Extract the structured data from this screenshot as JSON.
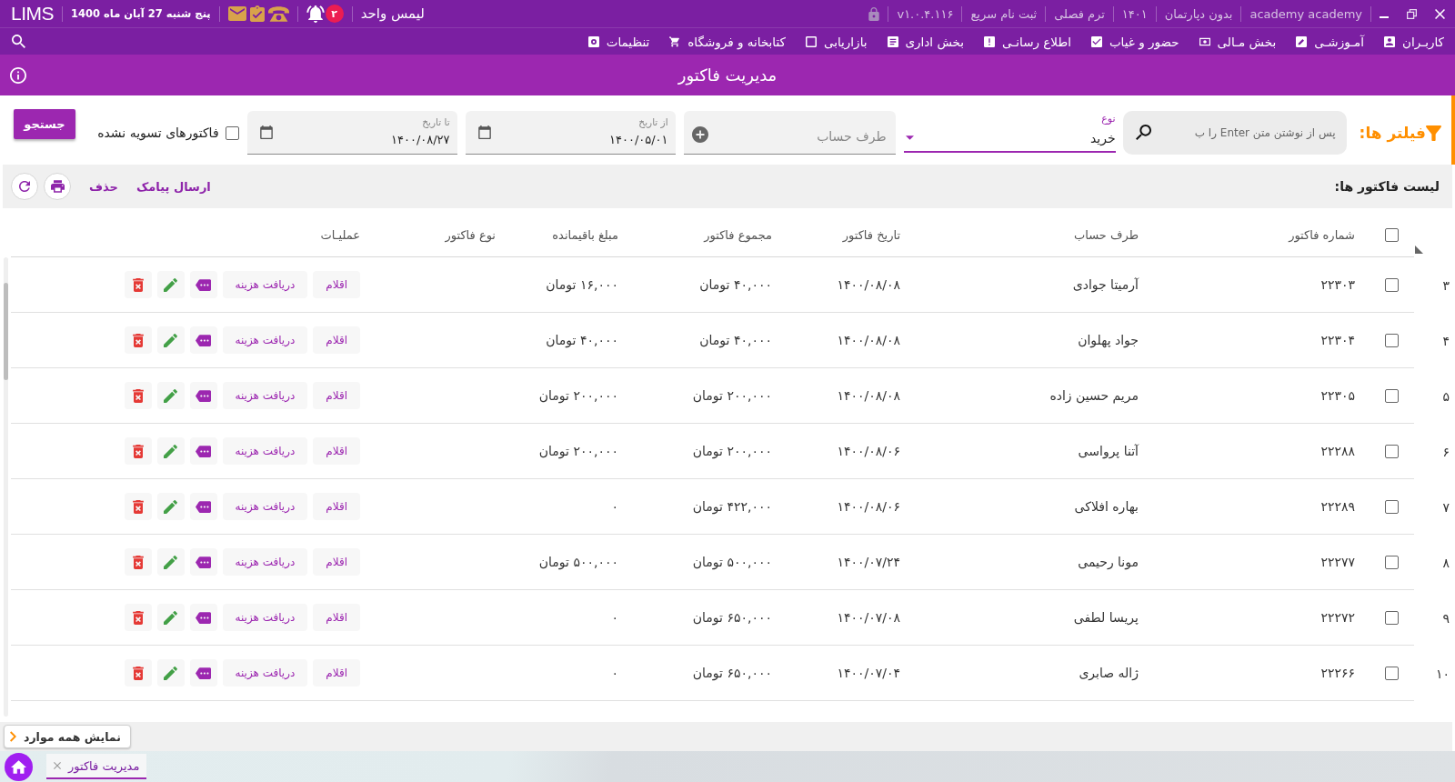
{
  "title_bar": {
    "info": [
      "academy academy",
      "بدون دپارتمان",
      "۱۴۰۱",
      "ترم فصلی",
      "ثبت نام سریع",
      "v۱.۰.۴.۱۱۶"
    ],
    "app_name": "لیمس واحد",
    "notification_count": "۲",
    "date": "پنج شنبه 27 آبان ماه 1400",
    "logo": "LIMS"
  },
  "menu": {
    "items": [
      "کاربـران",
      "آمـوزشـی",
      "بخش مـالی",
      "حضور و غیاب",
      "اطلاع رسانـی",
      "بخش اداری",
      "بازاریابی",
      "کتابخانه و فروشگاه",
      "تنظیمات"
    ]
  },
  "header": {
    "title": "مدیریت فاکتور"
  },
  "filters": {
    "title": "فیلتر ها:",
    "search": {
      "placeholder": "پس از نوشتن متن Enter را ب"
    },
    "type": {
      "label": "نوع",
      "value": "خرید"
    },
    "account": {
      "placeholder": "طرف حساب"
    },
    "from_date": {
      "label": "از تاریخ",
      "value": "۱۴۰۰/۰۵/۰۱"
    },
    "to_date": {
      "label": "تا تاریخ",
      "value": "۱۴۰۰/۰۸/۲۷"
    },
    "unsettled_only": {
      "label": "فاکتورهای تسویه نشده",
      "checked": false
    },
    "search_button": "جستجو"
  },
  "invoice_list": {
    "title": "لیست فاکتور ها:",
    "actions": [
      "ارسال پیامک",
      "حذف"
    ]
  },
  "table": {
    "all_checked": false,
    "columns": [
      "شماره فاکتور",
      "طرف حساب",
      "تاریخ فاکتور",
      "مجموع فاکتور",
      "مبلغ باقیمانده",
      "نوع فاکتور",
      "عملیـات"
    ],
    "rows": [
      {
        "index": "۳",
        "checked": false,
        "number": "۲۲۳۰۳",
        "account": "آرمیتا جوادی",
        "date": "۱۴۰۰/۰۸/۰۸",
        "total": "۴۰,۰۰۰ تومان",
        "remaining": "۱۶,۰۰۰ تومان",
        "buttons": [
          "اقلام",
          "دریافت هزینه"
        ]
      },
      {
        "index": "۴",
        "checked": false,
        "number": "۲۲۳۰۴",
        "account": "جواد پهلوان",
        "date": "۱۴۰۰/۰۸/۰۸",
        "total": "۴۰,۰۰۰ تومان",
        "remaining": "۴۰,۰۰۰ تومان",
        "buttons": [
          "اقلام",
          "دریافت هزینه"
        ]
      },
      {
        "index": "۵",
        "checked": false,
        "number": "۲۲۳۰۵",
        "account": "مریم حسین زاده",
        "date": "۱۴۰۰/۰۸/۰۸",
        "total": "۲۰۰,۰۰۰ تومان",
        "remaining": "۲۰۰,۰۰۰ تومان",
        "buttons": [
          "اقلام",
          "دریافت هزینه"
        ]
      },
      {
        "index": "۶",
        "checked": false,
        "number": "۲۲۲۸۸",
        "account": "آتنا پرواسی",
        "date": "۱۴۰۰/۰۸/۰۶",
        "total": "۲۰۰,۰۰۰ تومان",
        "remaining": "۲۰۰,۰۰۰ تومان",
        "buttons": [
          "اقلام",
          "دریافت هزینه"
        ]
      },
      {
        "index": "۷",
        "checked": false,
        "number": "۲۲۲۸۹",
        "account": "بهاره افلاکی",
        "date": "۱۴۰۰/۰۸/۰۶",
        "total": "۴۲۲,۰۰۰ تومان",
        "remaining": "۰",
        "buttons": [
          "اقلام",
          "دریافت هزینه"
        ]
      },
      {
        "index": "۸",
        "checked": false,
        "number": "۲۲۲۷۷",
        "account": "مونا رحیمی",
        "date": "۱۴۰۰/۰۷/۲۴",
        "total": "۵۰۰,۰۰۰ تومان",
        "remaining": "۵۰۰,۰۰۰ تومان",
        "buttons": [
          "اقلام",
          "دریافت هزینه"
        ]
      },
      {
        "index": "۹",
        "checked": false,
        "number": "۲۲۲۷۲",
        "account": "پریسا لطفی",
        "date": "۱۴۰۰/۰۷/۰۸",
        "total": "۶۵۰,۰۰۰ تومان",
        "remaining": "۰",
        "buttons": [
          "اقلام",
          "دریافت هزینه"
        ]
      },
      {
        "index": "۱۰",
        "checked": false,
        "number": "۲۲۲۶۶",
        "account": "ژاله صابری",
        "date": "۱۴۰۰/۰۷/۰۴",
        "total": "۶۵۰,۰۰۰ تومان",
        "remaining": "۰",
        "buttons": [
          "اقلام",
          "دریافت هزینه"
        ]
      }
    ]
  },
  "show_all_button": "نمایش همه موارد",
  "taskbar": {
    "tabs": [
      {
        "label": "مدیریت فاکتور",
        "selected": true
      }
    ]
  }
}
